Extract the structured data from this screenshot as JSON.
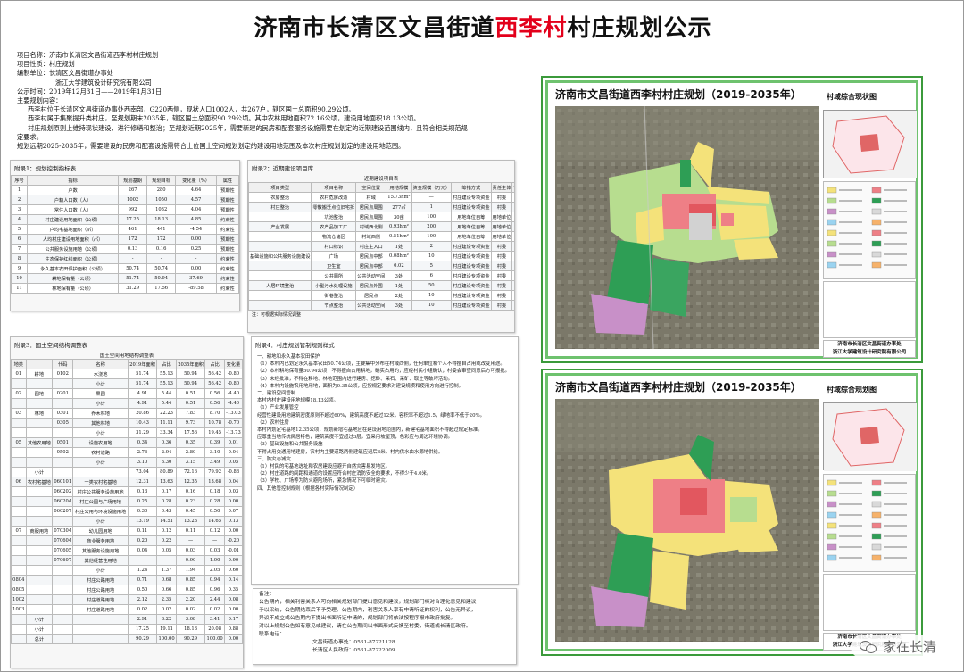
{
  "title_prefix": "济南市长清区文昌街道",
  "title_village": "西李村",
  "title_suffix": "村庄规划公示",
  "info": {
    "project_name": "项目名称：济南市长清区文昌街道西李村村庄规划",
    "project_type": "项目性质：村庄规划",
    "compiler1": "编制单位：长清区文昌街道办事处",
    "compiler2": "浙江大学建筑设计研究院有限公司",
    "period": "公示时间：2019年12月31日——2019年1月31日",
    "content_head": "主要规划内容：",
    "c1": "西李村位于长清区文昌街道办事处西南部，G220西侧，现状人口1002人，共267户，辖区国土总面积90.29公顷。",
    "c2": "西李村属于集聚提升类村庄，至规划期末2035年，辖区国土总面积90.29公顷。其中农林用地面积72.16公顷，建设用地面积18.13公顷。",
    "c3": "村庄规划原则上维持现状建设，进行修缮和整治；至规划近期2025年，需要新建的民房和配套服务设施需要在划定的近期建设范围线内，且符合相关规范规",
    "c4": "定要求。",
    "c5": "规划远期2025-2035年，需要建设的民房和配套设施需符合上位国土空间规划划定的建设用地范围及本次村庄规划划定的建设用地范围。"
  },
  "table1": {
    "title": "附录1：规划控制指标表",
    "headers": [
      "序号",
      "指标",
      "规划基期",
      "规划目标",
      "变化量（%）",
      "属性"
    ],
    "rows": [
      [
        "1",
        "户数",
        "267",
        "280",
        "4.64",
        "预期性"
      ],
      [
        "2",
        "户籍人口数（人）",
        "1002",
        "1050",
        "4.57",
        "预期性"
      ],
      [
        "3",
        "常住人口数（人）",
        "992",
        "1032",
        "4.04",
        "预期性"
      ],
      [
        "4",
        "村庄建设用地面积（公顷）",
        "17.25",
        "18.13",
        "4.85",
        "约束性"
      ],
      [
        "5",
        "户均宅基地面积（㎡）",
        "461",
        "441",
        "-4.54",
        "约束性"
      ],
      [
        "6",
        "人均村庄建设用地面积（㎡）",
        "172",
        "172",
        "0.00",
        "预期性"
      ],
      [
        "7",
        "公共服务设施用地（公顷）",
        "0.13",
        "0.16",
        "0.25",
        "预期性"
      ],
      [
        "8",
        "生态保护红线面积（公顷）",
        "-",
        "-",
        "-",
        "约束性"
      ],
      [
        "9",
        "永久基本农田保护面积（公顷）",
        "50.74",
        "50.74",
        "0.00",
        "约束性"
      ],
      [
        "10",
        "耕地保有量（公顷）",
        "51.74",
        "50.94",
        "37.69",
        "约束性"
      ],
      [
        "11",
        "林地保有量（公顷）",
        "31.29",
        "17.56",
        "-89.58",
        "约束性"
      ]
    ]
  },
  "table2": {
    "title": "附录2：近期建设项目库",
    "subtitle": "近期建设项目表",
    "headers": [
      "项目类型",
      "项目名称",
      "空间位置",
      "用地规模",
      "资金规模（万元）",
      "筹措方式",
      "责任主体",
      "协作部门",
      "建设方式"
    ],
    "rows": [
      [
        "农房整治",
        "农村危房改造",
        "村域",
        "15.73hm²",
        "—",
        "村庄建设专项资金",
        "村委",
        "农委",
        "复新"
      ],
      [
        "村庄整治",
        "零散搬迁点位旧宅拆",
        "居民点周围",
        "277㎡",
        "1",
        "村庄建设专项资金",
        "村委",
        "村委",
        "复垦"
      ],
      [
        "",
        "坑池整治",
        "居民点周围",
        "30亩",
        "100",
        "用地单位自筹",
        "用地单位",
        "村委",
        "改造"
      ],
      [
        "产业发展",
        "农产品加工厂",
        "村域西北侧",
        "0.93hm²",
        "200",
        "用地单位自筹",
        "用地单位",
        "",
        "新建"
      ],
      [
        "",
        "物流仓储区",
        "村域西侧",
        "0.51hm²",
        "100",
        "用地单位自筹",
        "用地单位",
        "",
        "新建"
      ],
      [
        "",
        "村口标识",
        "村庄主入口",
        "1处",
        "2",
        "村庄建设专项资金",
        "村委",
        "",
        "新建"
      ],
      [
        "基础设施和公共服务设施建设",
        "广场",
        "居民点中部",
        "0.08hm²",
        "10",
        "村庄建设专项资金",
        "村委",
        "",
        "改造"
      ],
      [
        "",
        "卫生室",
        "居民点中部",
        "0.02",
        "5",
        "村庄建设专项资金",
        "村委",
        "",
        "改造"
      ],
      [
        "",
        "公共厕所",
        "公共活动空间",
        "3处",
        "6",
        "村庄建设专项资金",
        "村委",
        "",
        "新建"
      ],
      [
        "人居环境整治",
        "小型污水处理设施",
        "居民点外围",
        "1处",
        "50",
        "村庄建设专项资金",
        "村委",
        "",
        "新建"
      ],
      [
        "",
        "街巷整治",
        "居民点",
        "2处",
        "10",
        "村庄建设专项资金",
        "村委",
        "",
        "改造"
      ],
      [
        "",
        "节点整治",
        "公共活动空间",
        "3处",
        "10",
        "村庄建设专项资金",
        "村委",
        "",
        "改造"
      ]
    ],
    "note": "注：可根据实际情况调整"
  },
  "table3": {
    "title": "附录3：国土空间结构调整表",
    "subtitle": "国土空间用地结构调整表",
    "headers": [
      "地类",
      "",
      "代码",
      "名称",
      "2019年面积",
      "占比",
      "2035年面积",
      "占比",
      "变化量"
    ],
    "rows": [
      [
        "01",
        "耕地",
        "0102",
        "水浇地",
        "51.74",
        "55.13",
        "50.94",
        "56.42",
        "-0.80"
      ],
      [
        "",
        "",
        "",
        "小计",
        "51.74",
        "55.13",
        "50.94",
        "56.42",
        "-0.80"
      ],
      [
        "02",
        "园地",
        "0201",
        "果园",
        "4.91",
        "5.44",
        "0.51",
        "0.56",
        "-4.40"
      ],
      [
        "",
        "",
        "",
        "小计",
        "4.91",
        "5.44",
        "0.51",
        "0.56",
        "-4.40"
      ],
      [
        "03",
        "林地",
        "0301",
        "乔木林地",
        "20.86",
        "22.23",
        "7.83",
        "8.70",
        "-13.03"
      ],
      [
        "",
        "",
        "0305",
        "其他林地",
        "10.43",
        "11.11",
        "9.73",
        "10.78",
        "-0.70"
      ],
      [
        "",
        "",
        "",
        "小计",
        "31.29",
        "33.34",
        "17.56",
        "19.45",
        "-13.73"
      ],
      [
        "05",
        "其他农用地",
        "0501",
        "设施农用地",
        "0.34",
        "0.36",
        "0.35",
        "0.39",
        "0.01"
      ],
      [
        "",
        "",
        "0502",
        "农村道路",
        "2.76",
        "2.94",
        "2.80",
        "3.10",
        "0.04"
      ],
      [
        "",
        "",
        "",
        "小计",
        "3.10",
        "3.30",
        "3.15",
        "3.49",
        "0.05"
      ],
      [
        "",
        "小计",
        "",
        "",
        "73.04",
        "80.89",
        "72.16",
        "79.92",
        "-0.88"
      ],
      [
        "06",
        "农村宅基地",
        "060101",
        "一类农村宅基地",
        "12.31",
        "13.63",
        "12.35",
        "13.68",
        "0.04"
      ],
      [
        "",
        "",
        "060202",
        "村庄公共服务设施用地",
        "0.13",
        "0.17",
        "0.16",
        "0.18",
        "0.03"
      ],
      [
        "",
        "",
        "060204",
        "村庄公园与广场用地",
        "0.25",
        "0.28",
        "0.23",
        "0.28",
        "0.00"
      ],
      [
        "",
        "",
        "060207",
        "村庄公用与环境设施用地",
        "0.30",
        "0.43",
        "0.45",
        "0.50",
        "0.07"
      ],
      [
        "",
        "",
        "",
        "小计",
        "13.19",
        "14.51",
        "13.23",
        "14.65",
        "0.13"
      ],
      [
        "07",
        "商服用地",
        "070304",
        "幼儿园用地",
        "0.11",
        "0.12",
        "0.11",
        "0.12",
        "0.00"
      ],
      [
        "",
        "",
        "070604",
        "商业服务用地",
        "0.20",
        "0.22",
        "—",
        "—",
        "-0.20"
      ],
      [
        "",
        "",
        "070605",
        "其他服务设施用地",
        "0.04",
        "0.05",
        "0.03",
        "0.03",
        "-0.01"
      ],
      [
        "",
        "",
        "070607",
        "其他经营性用地",
        "—",
        "—",
        "0.90",
        "1.00",
        "0.90"
      ],
      [
        "",
        "",
        "",
        "小计",
        "1.24",
        "1.37",
        "1.94",
        "2.05",
        "0.60"
      ],
      [
        "0804",
        "",
        "",
        "村庄公路用地",
        "0.71",
        "0.68",
        "0.85",
        "0.94",
        "0.14"
      ],
      [
        "0805",
        "",
        "",
        "村庄公路用地",
        "0.50",
        "0.66",
        "0.85",
        "0.96",
        "0.35"
      ],
      [
        "1002",
        "",
        "",
        "村庄道路用地",
        "2.12",
        "2.35",
        "2.20",
        "2.44",
        "0.08"
      ],
      [
        "1003",
        "",
        "",
        "村庄道路用地",
        "0.02",
        "0.02",
        "0.02",
        "0.02",
        "0.00"
      ],
      [
        "",
        "小计",
        "",
        "",
        "2.91",
        "3.22",
        "3.08",
        "3.41",
        "0.17"
      ],
      [
        "",
        "小计",
        "",
        "",
        "17.25",
        "19.11",
        "18.13",
        "20.08",
        "0.88"
      ],
      [
        "",
        "总计",
        "",
        "",
        "90.29",
        "100.00",
        "90.29",
        "100.00",
        "0.00"
      ]
    ]
  },
  "table4": {
    "title": "附录4：村庄规划管制规则样式",
    "lines": [
      "一、耕地和永久基本农田保护",
      "（1）本村内已划定永久基本农田50.74公顷，主要集中分布在村域西侧，任何单位和个人不得擅自占用或改变用途。",
      "（2）本村耕地保有量50.94公顷，不得擅自占用耕地，确实占用的，应经村民小组确认，村委会审查同意后方可报批。",
      "（3）未经批准，不得在耕地、林地范围内进行建房、挖砂、采石、采矿、取土等破坏活动。",
      "（4）本村内设施农用地用地，面积为0.35公顷，应按规定要求对建设规模和使用方向进行控制。",
      "二、建设空间管制",
      "本村内村庄建设用地规模18.13公顷。",
      "（1）产业发展管控",
      "经营性建设用地建筑密度原则不超过60%，建筑高度不超过12米，容积率不超过1.5，绿地率不低于20%。",
      "（2）农村住房",
      "本村内划定宅基地12.35公顷，规划新增宅基地应在建设用地范围内，新建宅基地面积不得超过规定标准。",
      "应尊重当地传统民居特色，建筑高度不宜超过3层，宜采用坡屋顶，色彩应与周边环境协调。",
      "（3）基础设施和公共服务设施",
      "不得占用交通用地建房，农村内主要道路两侧建筑应退后3米，村内供水由水源地供给。",
      "三、防灾与减灾",
      "（1）村民的宅基地选址和农房建设应避开自然灾害易发地区。",
      "（2）村庄道路的间距和通道的设置应符合村庄消防安全的要求，不得少于4.0米。",
      "（3）学校、广场等为防火避险场所，紧急情况下可临时避灾。",
      "四、其他管控制规则（根据各村实际情况制定）"
    ]
  },
  "notes": {
    "head": "备注：",
    "l1": "公告期内，相关利害关系人可向相关规划部门提出意见和建议，规划部门将对合理化意见和建议",
    "l2": "予以采纳，公告期结束后不予受理。公告期内，利害关系人享有申请听证的权利，公告无异议，",
    "l3": "异议不成立或公告期内不提出书面听证申请的，规划部门将依法按程序报市政府批复。",
    "l4": "对以上规划公告如有意见或建议，请在公告期间以书面形式反馈至村委，街道或长清区政府。",
    "l5": "联系电话：",
    "tel1": "文昌街道办事处：0531-87221128",
    "tel2": "长清区人民政府：0531-87222009"
  },
  "map1": {
    "title": "济南市文昌街道西李村村庄规划（2019-2035年）",
    "subtitle": "村域综合现状图",
    "org1": "济南市长清区文昌街道办事处",
    "org2": "浙江大学建筑设计研究院有限公司"
  },
  "map2": {
    "title": "济南市文昌街道西李村村庄规划（2019-2035年）",
    "subtitle": "村域综合规划图",
    "org1": "济南市长清区文昌街道办事处",
    "org2": "浙江大学建筑设计研究院有限公司"
  },
  "watermark": "家在长清",
  "colors": {
    "title_highlight": "#e3001b",
    "map_frame": "#3b9a3b",
    "residential": "#f4e27a",
    "public": "#ee7f86",
    "farmland": "#b7dd8f",
    "forest": "#2e9e55",
    "industry": "#c890c8"
  }
}
